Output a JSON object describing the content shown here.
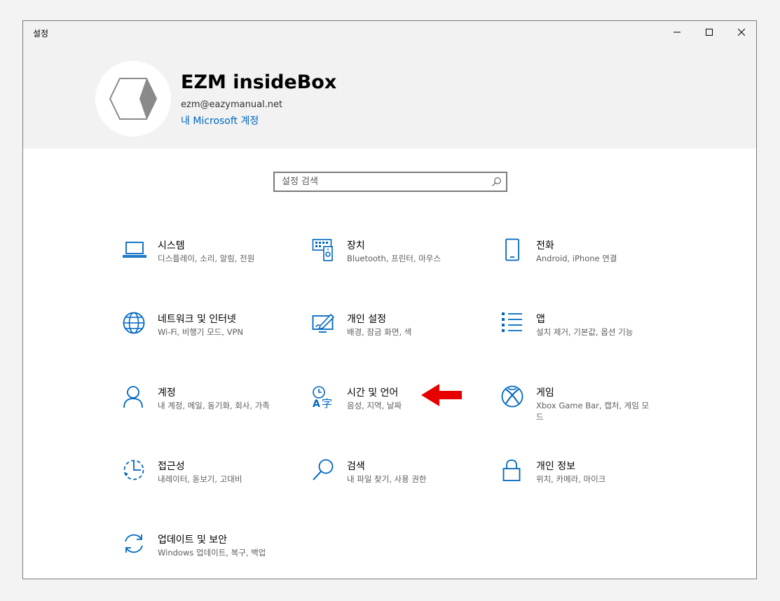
{
  "window": {
    "title": "설정"
  },
  "profile": {
    "name": "EZM insideBox",
    "email": "ezm@eazymanual.net",
    "link": "내 Microsoft 계정"
  },
  "search": {
    "placeholder": "설정 검색"
  },
  "accent_color": "#0067c0",
  "annotation_color": "#e60000",
  "tiles": [
    {
      "title": "시스템",
      "subtitle": "디스플레이, 소리, 알림, 전원",
      "icon": "laptop-icon"
    },
    {
      "title": "장치",
      "subtitle": "Bluetooth, 프린터, 마우스",
      "icon": "devices-icon"
    },
    {
      "title": "전화",
      "subtitle": "Android, iPhone 연결",
      "icon": "phone-icon"
    },
    {
      "title": "네트워크 및 인터넷",
      "subtitle": "Wi-Fi, 비행기 모드, VPN",
      "icon": "globe-icon"
    },
    {
      "title": "개인 설정",
      "subtitle": "배경, 잠금 화면, 색",
      "icon": "personalize-icon"
    },
    {
      "title": "앱",
      "subtitle": "설치 제거, 기본값, 옵션 기능",
      "icon": "apps-list-icon"
    },
    {
      "title": "계정",
      "subtitle": "내 계정, 메일, 동기화, 회사, 가족",
      "icon": "person-icon"
    },
    {
      "title": "시간 및 언어",
      "subtitle": "음성, 지역, 날짜",
      "icon": "time-language-icon"
    },
    {
      "title": "게임",
      "subtitle": "Xbox Game Bar, 캡처, 게임 모드",
      "icon": "xbox-icon"
    },
    {
      "title": "접근성",
      "subtitle": "내레이터, 돋보기, 고대비",
      "icon": "accessibility-icon"
    },
    {
      "title": "검색",
      "subtitle": "내 파일 찾기, 사용 권한",
      "icon": "search-magnifier-icon"
    },
    {
      "title": "개인 정보",
      "subtitle": "위치, 카메라, 마이크",
      "icon": "lock-icon"
    },
    {
      "title": "업데이트 및 보안",
      "subtitle": "Windows 업데이트, 복구, 백업",
      "icon": "update-icon"
    }
  ]
}
